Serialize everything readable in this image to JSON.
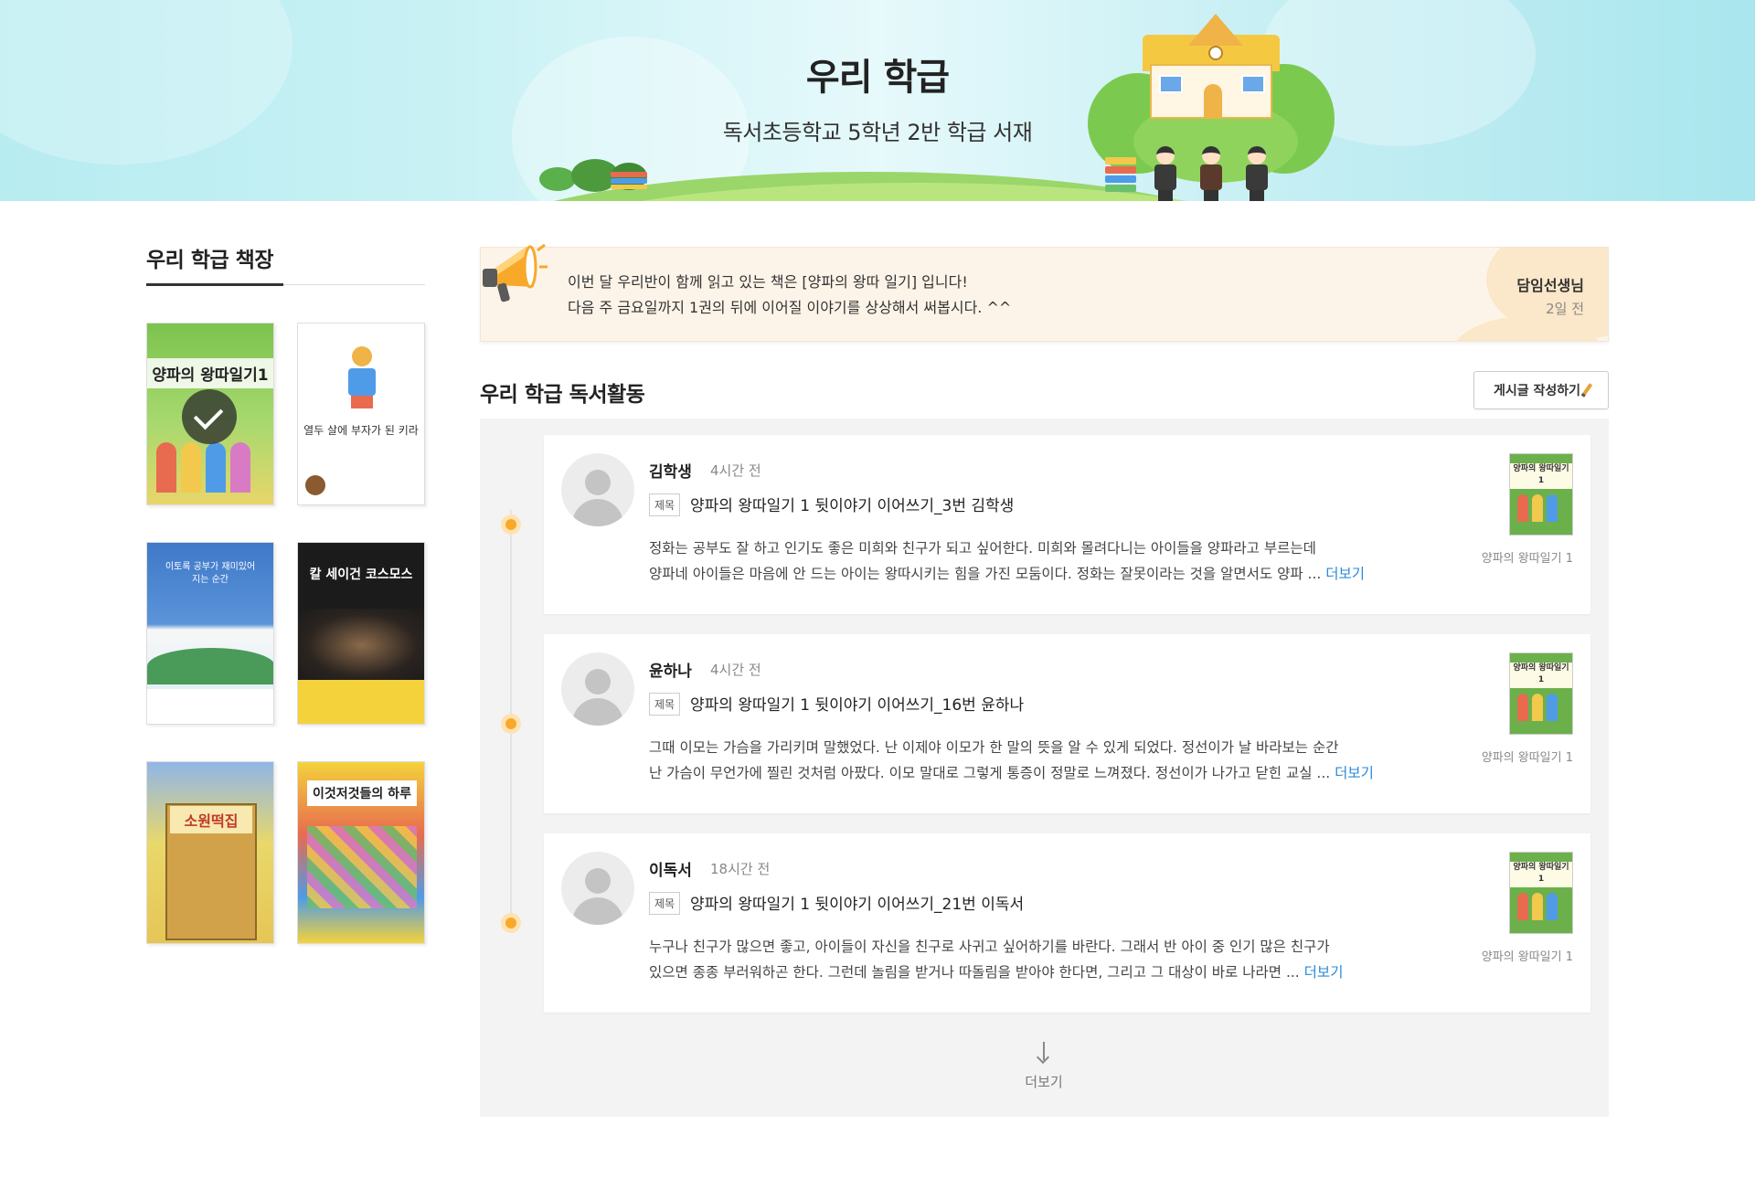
{
  "header": {
    "title": "우리 학급",
    "subtitle": "독서초등학교 5학년 2반 학급 서재"
  },
  "shelf": {
    "title": "우리 학급 책장",
    "books": [
      {
        "title": "양파의 왕따일기1",
        "selected": true,
        "color": "#7cc34f"
      },
      {
        "title": "열두 살에 부자가 된 키라",
        "selected": false,
        "color": "#ffffff"
      },
      {
        "title": "이토록 공부가 재미있어지는 순간",
        "selected": false,
        "color": "#3f79c9"
      },
      {
        "title": "칼 세이건 코스모스",
        "selected": false,
        "color": "#1b1b1b"
      },
      {
        "title": "소원떡집",
        "selected": false,
        "color": "#e9d86a"
      },
      {
        "title": "이것저것들의 하루",
        "selected": false,
        "color": "#f4d23b"
      }
    ]
  },
  "notice": {
    "line1": "이번 달 우리반이 함께 읽고 있는 책은 [양파의 왕따 일기] 입니다!",
    "line2": "다음 주 금요일까지 1권의 뒤에 이어질 이야기를 상상해서 써봅시다. ^^",
    "author": "담임선생님",
    "time": "2일 전",
    "icon": "megaphone-icon"
  },
  "activity": {
    "title": "우리 학급 독서활동",
    "write_button": "게시글 작성하기",
    "label": "제목",
    "more_link": "더보기",
    "load_more": "더보기",
    "posts": [
      {
        "author": "김학생",
        "time": "4시간 전",
        "title": "양파의 왕따일기 1 뒷이야기 이어쓰기_3번 김학생",
        "line1": "정화는 공부도 잘 하고 인기도 좋은 미희와 친구가 되고 싶어한다. 미희와 몰려다니는 아이들을 양파라고 부르는데",
        "line2": "양파네 아이들은 마음에 안 드는 아이는 왕따시키는 힘을 가진 모둠이다. 정화는 잘못이라는 것을 알면서도 양파 ...",
        "book": "양파의 왕따일기 1"
      },
      {
        "author": "윤하나",
        "time": "4시간 전",
        "title": "양파의 왕따일기 1 뒷이야기 이어쓰기_16번 윤하나",
        "line1": "그때 이모는 가슴을 가리키며 말했었다. 난 이제야 이모가 한 말의 뜻을 알 수 있게 되었다. 정선이가 날 바라보는 순간",
        "line2": "난 가슴이 무언가에 찔린 것처럼 아팠다. 이모 말대로 그렇게 통증이 정말로 느껴졌다. 정선이가 나가고 닫힌 교실 ...",
        "book": "양파의 왕따일기 1"
      },
      {
        "author": "이독서",
        "time": "18시간 전",
        "title": "양파의 왕따일기 1 뒷이야기 이어쓰기_21번 이독서",
        "line1": "누구나 친구가 많으면 좋고, 아이들이 자신을 친구로 사귀고 싶어하기를 바란다. 그래서 반 아이 중 인기 많은 친구가",
        "line2": "있으면 종종 부러워하곤 한다. 그런데 놀림을 받거나 따돌림을 받아야 한다면, 그리고 그 대상이 바로 나라면 ...",
        "book": "양파의 왕따일기 1"
      }
    ]
  },
  "colors": {
    "accent": "#f8a92a",
    "link": "#2a8ad8",
    "banner": "#c8f1f4"
  }
}
